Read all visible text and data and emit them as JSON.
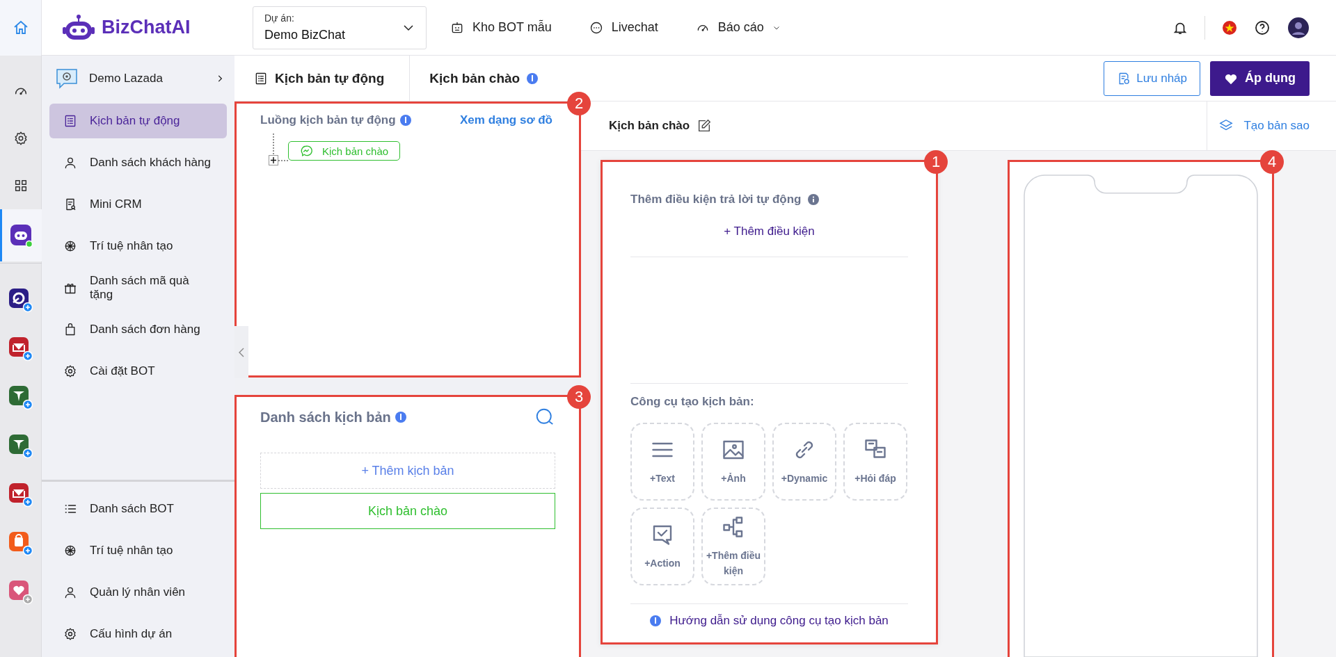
{
  "top_bar": {
    "logo": "BizChatAI",
    "project": {
      "label": "Dự án:",
      "value": "Demo BizChat"
    },
    "nav": [
      {
        "label": "Kho BOT mẫu",
        "kind": "bot",
        "dropdown": false
      },
      {
        "label": "Livechat",
        "kind": "chat",
        "dropdown": false
      },
      {
        "label": "Báo cáo",
        "kind": "gauge",
        "dropdown": true
      }
    ]
  },
  "rail": {
    "items": [
      {
        "kind": "gauge",
        "selected": false
      },
      {
        "kind": "gear",
        "selected": false
      },
      {
        "kind": "grid",
        "selected": false
      },
      {
        "kind": "bot",
        "selected": true
      }
    ],
    "apps": [
      {
        "kind": "swirl",
        "color": "#2b1e86",
        "available": true
      },
      {
        "kind": "mail",
        "color": "#c0222c",
        "available": true
      },
      {
        "kind": "plane",
        "color": "#2e6b35",
        "available": true
      },
      {
        "kind": "plane",
        "color": "#2e6b35",
        "available": true
      },
      {
        "kind": "mail",
        "color": "#c0222c",
        "available": true
      },
      {
        "kind": "bag",
        "color": "#f25c1b",
        "available": true
      },
      {
        "kind": "heart",
        "color": "#d9567a",
        "available": false
      }
    ]
  },
  "sidebar": {
    "bot": "Demo Lazada",
    "items": [
      {
        "label": "Kịch bản tự động",
        "kind": "list",
        "selected": true
      },
      {
        "label": "Danh sách khách hàng",
        "kind": "user",
        "selected": false
      },
      {
        "label": "Mini CRM",
        "kind": "doc",
        "selected": false
      },
      {
        "label": "Trí tuệ nhân tạo",
        "kind": "ai",
        "selected": false
      },
      {
        "label": "Danh sách mã quà tặng",
        "kind": "gift",
        "selected": false
      },
      {
        "label": "Danh sách đơn hàng",
        "kind": "bag",
        "selected": false
      },
      {
        "label": "Cài đặt BOT",
        "kind": "gear",
        "selected": false
      }
    ],
    "footer_items": [
      {
        "label": "Danh sách BOT",
        "kind": "lines"
      },
      {
        "label": "Trí tuệ nhân tạo",
        "kind": "ai"
      },
      {
        "label": "Quản lý nhân viên",
        "kind": "user"
      },
      {
        "label": "Cấu hình dự án",
        "kind": "gear"
      }
    ]
  },
  "breadcrumb": [
    {
      "label": "Kịch bản tự động",
      "info": false
    },
    {
      "label": "Kịch bản chào",
      "info": true
    }
  ],
  "actions": {
    "draft": "Lưu nháp",
    "apply": "Áp dụng"
  },
  "flow_panel": {
    "callout": "2",
    "title": "Luồng kịch bản tự động",
    "link": "Xem dạng sơ đồ",
    "nodes": [
      {
        "label": "Kịch bản chào"
      }
    ]
  },
  "list_panel": {
    "callout": "3",
    "title": "Danh sách kịch bản",
    "add": "+ Thêm kịch bản",
    "items": [
      {
        "label": "Kịch bản chào",
        "selected": true
      }
    ]
  },
  "editor": {
    "title": "Kịch bản chào",
    "copy": "Tạo bản sao"
  },
  "condition_panel": {
    "callout": "1",
    "title": "Thêm điều kiện trả lời tự động",
    "add": "+ Thêm điều kiện",
    "tools_title": "Công cụ tạo kịch bản:",
    "tools": [
      {
        "kind": "text",
        "label": "+Text"
      },
      {
        "kind": "image",
        "label": "+Ảnh"
      },
      {
        "kind": "link",
        "label": "+Dynamic"
      },
      {
        "kind": "qa",
        "label": "+Hỏi đáp"
      },
      {
        "kind": "action",
        "label": "+Action"
      },
      {
        "kind": "tree",
        "label": "+Thêm điều kiện"
      }
    ],
    "guide": "Hướng dẫn sử dụng công cụ tạo kịch bản"
  },
  "preview": {
    "callout": "4"
  }
}
